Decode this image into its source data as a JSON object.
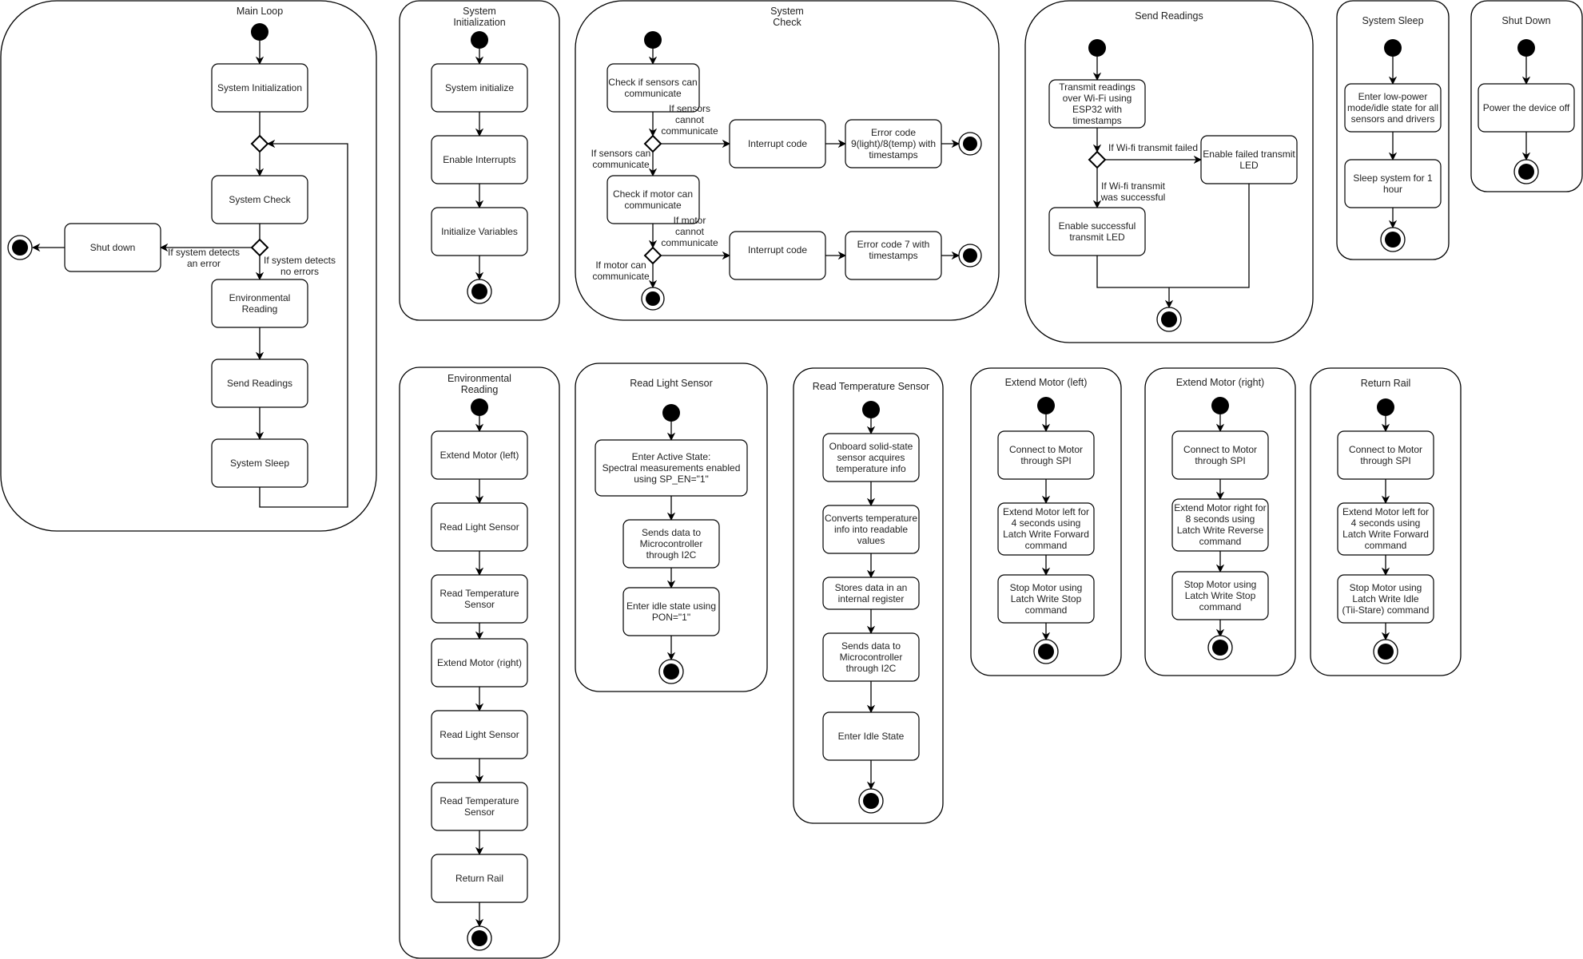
{
  "diagram": {
    "main_loop": {
      "title": "Main Loop",
      "nodes": [
        "System Initialization",
        "System Check",
        "Shut down",
        "Environmental|Reading",
        "Send Readings",
        "System Sleep"
      ],
      "guards": [
        "If system detects|an error",
        "If system detects|no errors"
      ]
    },
    "system_initialization": {
      "title": "System|Initialization",
      "nodes": [
        "System initialize",
        "Enable Interrupts",
        "Initialize Variables"
      ]
    },
    "system_check": {
      "title": "System|Check",
      "nodes": [
        "Check if sensors can|communicate",
        "Interrupt code",
        "Error code|9(light)/8(temp) with|timestamps",
        "Check if motor can|communicate",
        "Interrupt code",
        "Error code 7 with|timestamps"
      ],
      "guards": [
        "If sensors|cannot|communicate",
        "If sensors can|communicate",
        "If motor|cannot|communicate",
        "If motor can|communicate"
      ]
    },
    "send_readings": {
      "title": "Send Readings",
      "nodes": [
        "Transmit readings|over Wi-Fi using|ESP32 with|timestamps",
        "Enable failed transmit|LED",
        "Enable successful|transmit LED"
      ],
      "guards": [
        "If Wi-fi transmit failed",
        "If Wi-fi transmit|was successful"
      ]
    },
    "system_sleep": {
      "title": "System Sleep",
      "nodes": [
        "Enter low-power|mode/idle state for all|sensors and drivers",
        "Sleep system for 1|hour"
      ]
    },
    "shut_down": {
      "title": "Shut Down",
      "nodes": [
        "Power the device off"
      ]
    },
    "environmental_reading": {
      "title": "Environmental|Reading",
      "nodes": [
        "Extend Motor (left)",
        "Read Light Sensor",
        "Read Temperature|Sensor",
        "Extend Motor (right)",
        "Read Light Sensor",
        "Read Temperature|Sensor",
        "Return Rail"
      ]
    },
    "read_light_sensor": {
      "title": "Read Light Sensor",
      "nodes": [
        "Enter Active State:|Spectral measurements enabled|using SP_EN=\"1\"",
        "Sends data to|Microcontroller|through I2C",
        "Enter idle state using|PON=\"1\""
      ]
    },
    "read_temperature_sensor": {
      "title": "Read Temperature Sensor",
      "nodes": [
        "Onboard solid-state|sensor acquires|temperature info",
        "Converts temperature|info into readable|values",
        "Stores data in an|internal register",
        "Sends data to|Microcontroller|through I2C",
        "Enter Idle State"
      ]
    },
    "extend_motor_left": {
      "title": "Extend Motor (left)",
      "nodes": [
        "Connect to Motor|through SPI",
        "Extend Motor left for|4 seconds using|Latch Write Forward|command",
        "Stop Motor using|Latch Write Stop|command"
      ]
    },
    "extend_motor_right": {
      "title": "Extend Motor (right)",
      "nodes": [
        "Connect to Motor|through SPI",
        "Extend Motor right for|8 seconds using|Latch Write Reverse|command",
        "Stop Motor using|Latch Write Stop|command"
      ]
    },
    "return_rail": {
      "title": "Return Rail",
      "nodes": [
        "Connect to Motor|through SPI",
        "Extend Motor left for|4 seconds using|Latch Write Forward|command",
        "Stop Motor using|Latch Write Idle|(Tii-Stare) command"
      ]
    }
  }
}
